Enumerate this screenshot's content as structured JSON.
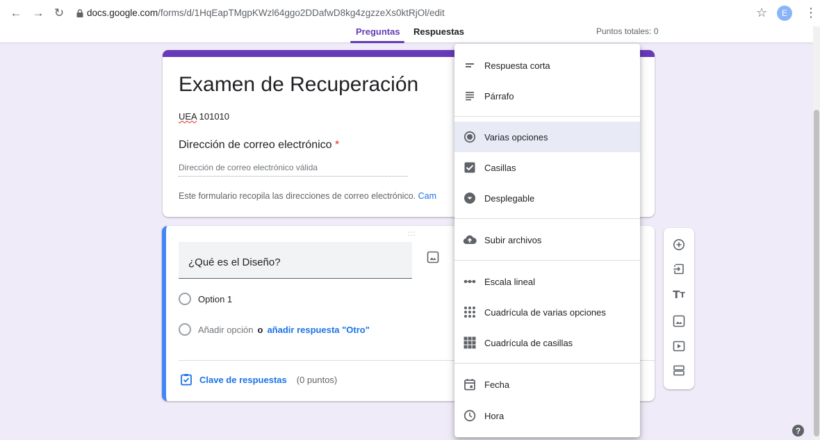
{
  "browser": {
    "url_host": "docs.google.com",
    "url_path": "/forms/d/1HqEapTMgpKWzl64ggo2DDafwD8kg4zgzzeXs0ktRjOl/edit",
    "avatar_letter": "E"
  },
  "header": {
    "tab_questions": "Preguntas",
    "tab_responses": "Respuestas",
    "total_points": "Puntos totales: 0"
  },
  "form": {
    "title": "Examen de Recuperación",
    "desc_prefix": "UEA",
    "desc_rest": " 101010",
    "email_label": "Dirección de correo electrónico",
    "email_required": "*",
    "email_placeholder": "Dirección de correo electrónico válida",
    "email_note": "Este formulario recopila las direcciones de correo electrónico.",
    "email_note_link": "Cam"
  },
  "question": {
    "drag": ":::",
    "text": "¿Qué es el Diseño?",
    "option1": "Option 1",
    "add_option": "Añadir opción",
    "or": "o",
    "add_other": "añadir respuesta \"Otro\"",
    "answer_key": "Clave de respuestas",
    "points": "(0 puntos)"
  },
  "menu": {
    "items": [
      {
        "label": "Respuesta corta",
        "icon": "short-answer-icon"
      },
      {
        "label": "Párrafo",
        "icon": "paragraph-icon"
      },
      {
        "label": "Varias opciones",
        "icon": "radio-selected-icon",
        "selected": true
      },
      {
        "label": "Casillas",
        "icon": "checkbox-icon"
      },
      {
        "label": "Desplegable",
        "icon": "dropdown-icon"
      },
      {
        "label": "Subir archivos",
        "icon": "cloud-upload-icon"
      },
      {
        "label": "Escala lineal",
        "icon": "linear-scale-icon"
      },
      {
        "label": "Cuadrícula de varias opciones",
        "icon": "grid-dots-icon"
      },
      {
        "label": "Cuadrícula de casillas",
        "icon": "grid-squares-icon"
      },
      {
        "label": "Fecha",
        "icon": "calendar-icon"
      },
      {
        "label": "Hora",
        "icon": "clock-icon"
      }
    ]
  },
  "toolbar": {
    "tools": [
      "add-question-icon",
      "import-icon",
      "title-text-icon",
      "image-icon",
      "video-icon",
      "section-icon"
    ]
  },
  "help": "?",
  "colors": {
    "accent": "#673ab7",
    "active_border": "#4285f4",
    "link": "#1a73e8",
    "background": "#f0ebf8"
  }
}
